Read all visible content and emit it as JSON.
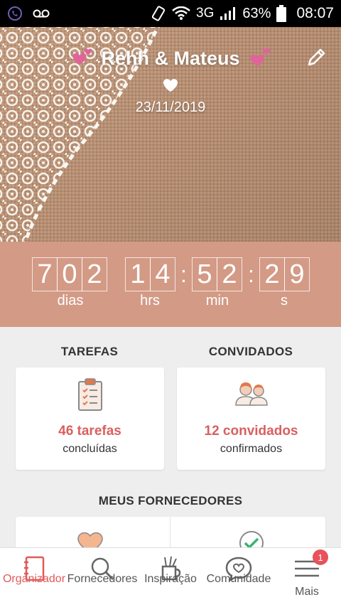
{
  "status_bar": {
    "network": "3G",
    "battery": "63%",
    "time": "08:07"
  },
  "hero": {
    "couple_name": "Rehh & Mateus",
    "wedding_date": "23/11/2019"
  },
  "countdown": {
    "days": [
      "7",
      "0",
      "2"
    ],
    "hours": [
      "1",
      "4"
    ],
    "minutes": [
      "5",
      "2"
    ],
    "seconds": [
      "2",
      "9"
    ],
    "separator": ":",
    "labels": {
      "days": "dias",
      "hours": "hrs",
      "minutes": "min",
      "seconds": "s"
    }
  },
  "tasks": {
    "title": "TAREFAS",
    "count": "46 tarefas",
    "subtitle": "concluídas"
  },
  "guests": {
    "title": "CONVIDADOS",
    "count": "12 convidados",
    "subtitle": "confirmados"
  },
  "vendors": {
    "title": "MEUS FORNECEDORES"
  },
  "bottom_nav": {
    "items": [
      {
        "label": "Organizador",
        "icon": "notebook-icon",
        "active": true
      },
      {
        "label": "Fornecedores",
        "icon": "search-icon",
        "active": false
      },
      {
        "label": "Inspiração",
        "icon": "brushes-icon",
        "active": false
      },
      {
        "label": "Comunidade",
        "icon": "chat-heart-icon",
        "active": false
      },
      {
        "label": "Mais",
        "icon": "menu-icon",
        "active": false,
        "badge": "1"
      }
    ]
  },
  "colors": {
    "accent": "#d9605f",
    "countdown_bg": "#d39a86",
    "active_nav": "#e05a5a"
  }
}
